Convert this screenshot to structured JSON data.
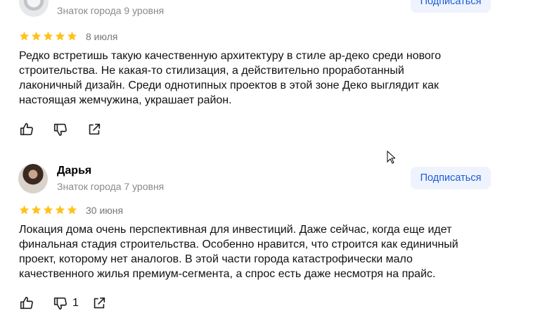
{
  "reviews": [
    {
      "author": "",
      "level": "Знаток города 9 уровня",
      "subscribe_label": "Подписаться",
      "rating": 5,
      "date": "8 июля",
      "text": "Редко встретишь такую качественную архитектуру в стиле ар-деко среди нового\nстроительства. Не какая-то стилизация, а действительно проработанный\nлаконичный дизайн. Среди однотипных проектов в этой зоне Деко выглядит как\nнастоящая жемчужина, украшает район.",
      "dislike_count": ""
    },
    {
      "author": "Дарья",
      "level": "Знаток города 7 уровня",
      "subscribe_label": "Подписаться",
      "rating": 5,
      "date": "30 июня",
      "text": "Локация дома очень перспективная для инвестиций. Даже сейчас, когда еще идет\nфинальная стадия строительства. Особенно нравится, что строится как единичный\nпроект, которому нет аналогов. В этой части города катастрофически мало\nкачественного жилья премиум-сегмента, а спрос есть даже несмотря на прайс.",
      "dislike_count": "1"
    }
  ],
  "colors": {
    "star": "#ffc21a",
    "subscribe_bg": "#eef3fe",
    "subscribe_text": "#1a5bd6",
    "meta_text": "#8a8a8a"
  },
  "icons": [
    "like-icon",
    "dislike-icon",
    "share-icon",
    "star-icon"
  ]
}
